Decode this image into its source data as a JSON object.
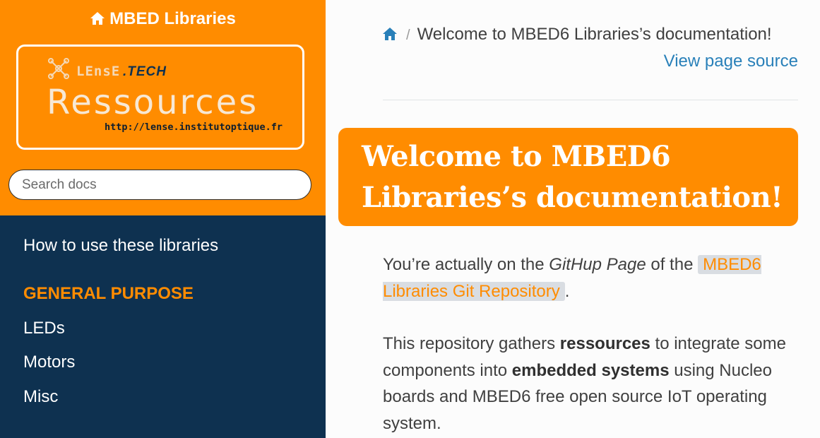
{
  "sidebar": {
    "project_title": "MBED Libraries",
    "logo": {
      "brand": "LEnsE",
      "brand_suffix": ".TECH",
      "title": "Ressources",
      "url": "http://lense.institutoptique.fr"
    },
    "search": {
      "placeholder": "Search docs"
    },
    "nav": [
      {
        "label": "How to use these libraries",
        "type": "link"
      },
      {
        "label": "GENERAL PURPOSE",
        "type": "caption"
      },
      {
        "label": "LEDs",
        "type": "link"
      },
      {
        "label": "Motors",
        "type": "link"
      },
      {
        "label": "Misc",
        "type": "link"
      }
    ]
  },
  "breadcrumb": {
    "current": "Welcome to MBED6 Libraries’s documentation!",
    "separator": "/",
    "view_source": "View page source"
  },
  "main": {
    "heading": "Welcome to MBED6 Libraries’s documentation!",
    "para1": {
      "t1": "You’re actually on the ",
      "em": "GitHup Page",
      "t2": " of the ",
      "link": "MBED6 Libraries Git Repository",
      "t3": "."
    },
    "para2": {
      "t1": "This repository gathers ",
      "b1": "ressources",
      "t2": " to integrate some components into ",
      "b2": "embedded systems",
      "t3": " using Nucleo boards and MBED6 free open source IoT operating system."
    }
  },
  "colors": {
    "accent": "#ff8c00",
    "sidebar_bg": "#0e3150",
    "link": "#2980b9",
    "text": "#404040"
  },
  "icons": {
    "home": "home-icon",
    "logo": "network-nodes-icon"
  }
}
